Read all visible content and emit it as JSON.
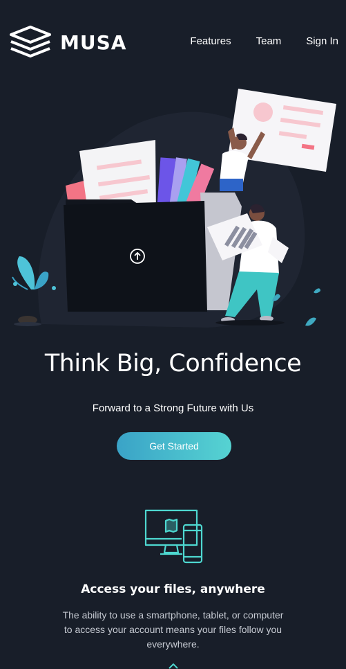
{
  "header": {
    "brand": "MUSA",
    "logo_icon": "stacked-layers-icon",
    "nav": [
      {
        "label": "Features"
      },
      {
        "label": "Team"
      },
      {
        "label": "Sign In"
      }
    ]
  },
  "hero": {
    "illustration": "people-filing-documents-illustration",
    "upload_icon": "arrow-up-circle-icon",
    "headline": "Think Big, Confidence",
    "subheadline": "Forward to a Strong Future with Us",
    "cta_label": "Get Started"
  },
  "feature": {
    "icon": "monitor-and-phone-icon",
    "title": "Access your files, anywhere",
    "description": "The ability to use a smartphone, tablet, or computer to access your account means your files follow you everywhere."
  },
  "colors": {
    "background": "#181e29",
    "accent_start": "#3aa3c7",
    "accent_end": "#56d3d2",
    "icon_teal": "#4ed8d0"
  }
}
